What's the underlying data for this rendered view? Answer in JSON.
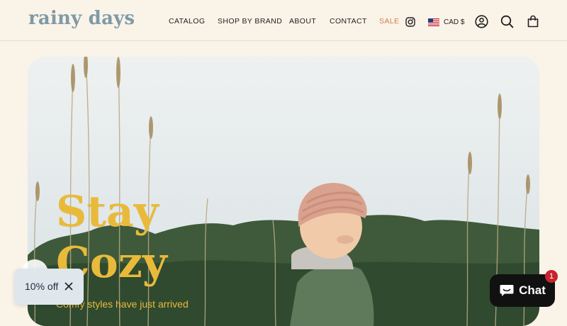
{
  "brand": {
    "logo_text": "rainy days"
  },
  "nav": {
    "items": [
      {
        "label": "CATALOG"
      },
      {
        "label": "SHOP BY BRAND"
      },
      {
        "label": "ABOUT"
      },
      {
        "label": "CONTACT"
      },
      {
        "label": "SALE"
      }
    ]
  },
  "currency": {
    "label": "CAD $",
    "flag_icon": "us-flag-icon"
  },
  "header_icons": [
    "instagram-icon",
    "account-icon",
    "search-icon",
    "cart-icon"
  ],
  "hero": {
    "title_line1": "Stay",
    "title_line2": "Cozy",
    "subtitle": "Comfy styles have just arrived"
  },
  "promo": {
    "label": "10% off",
    "close_icon": "close-icon"
  },
  "chat": {
    "label": "Chat",
    "badge_count": "1",
    "icon": "chat-bubble-icon"
  },
  "colors": {
    "background": "#faf3e8",
    "logo": "#7f9aa6",
    "sale": "#d37a55",
    "hero_text": "#e9ba3a",
    "chat_button": "#111111",
    "badge": "#c8242e"
  }
}
